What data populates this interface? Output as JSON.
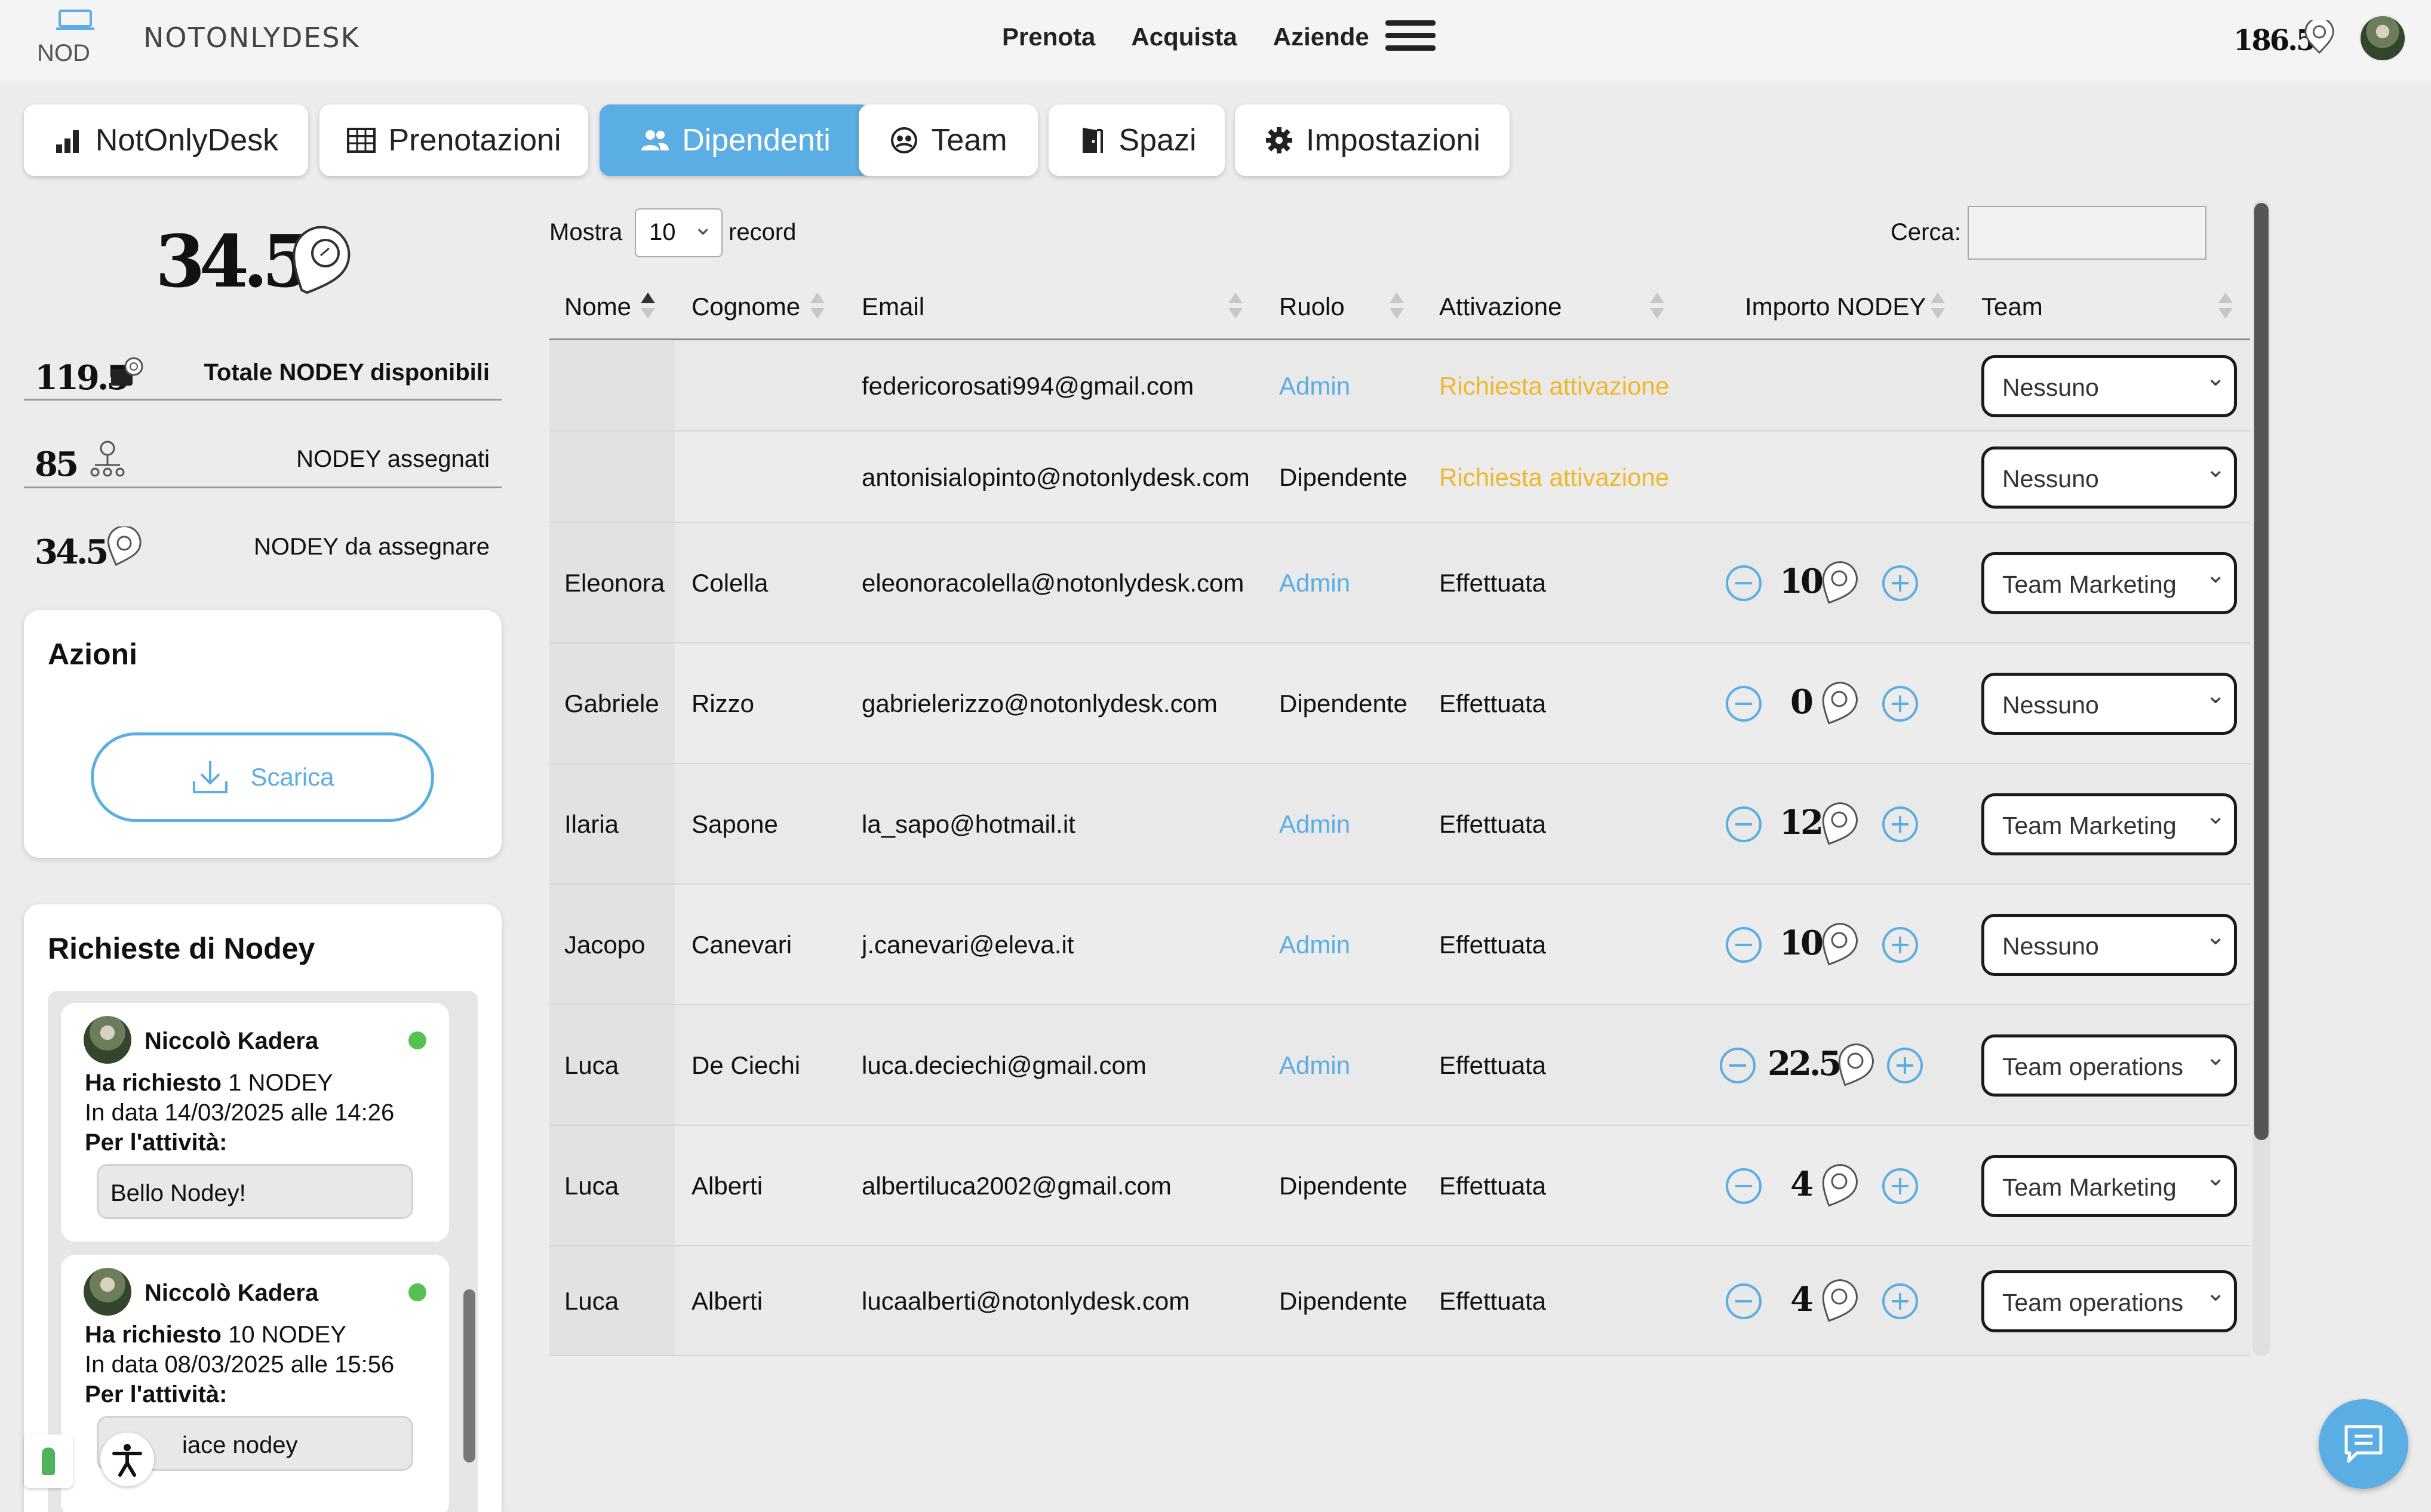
{
  "header": {
    "brand": "NOTONLYDESK",
    "logo_text": "NOD",
    "nav": [
      {
        "label": "Prenota"
      },
      {
        "label": "Acquista"
      },
      {
        "label": "Aziende"
      }
    ],
    "balance": "186.5",
    "balance_icon": "nodey-coin-icon",
    "menu_icon": "hamburger-icon"
  },
  "tabs": [
    {
      "label": "NotOnlyDesk",
      "icon": "bar-chart-icon"
    },
    {
      "label": "Prenotazioni",
      "icon": "table-icon"
    },
    {
      "label": "Dipendenti",
      "icon": "users-icon",
      "active": true
    },
    {
      "label": "Team",
      "icon": "team-icon"
    },
    {
      "label": "Spazi",
      "icon": "door-icon"
    },
    {
      "label": "Impostazioni",
      "icon": "gear-icon"
    }
  ],
  "summary": {
    "big_value": "34.5",
    "stats": [
      {
        "value": "119.5",
        "label": "Totale NODEY disponibili",
        "icon": "wallet-icon"
      },
      {
        "value": "85",
        "label": "NODEY assegnati",
        "icon": "network-icon"
      },
      {
        "value": "34.5",
        "label": "NODEY da assegnare",
        "icon": "nodey-coin-icon"
      }
    ]
  },
  "actions": {
    "title": "Azioni",
    "download_label": "Scarica"
  },
  "requests": {
    "title": "Richieste di Nodey",
    "items": [
      {
        "name": "Niccolò Kadera",
        "requested_prefix": "Ha richiesto",
        "requested_value": "1 NODEY",
        "date": "In data 14/03/2025 alle 14:26",
        "activity_label": "Per l'attività:",
        "activity": "Bello Nodey!"
      },
      {
        "name": "Niccolò Kadera",
        "requested_prefix": "Ha richiesto",
        "requested_value": "10 NODEY",
        "date": "In data 08/03/2025 alle 15:56",
        "activity_label": "Per l'attività:",
        "activity": "iace nodey"
      }
    ]
  },
  "table_controls": {
    "show_label": "Mostra",
    "page_length": "10",
    "record_label": "record",
    "search_label": "Cerca:",
    "search_value": ""
  },
  "table": {
    "columns": [
      "Nome",
      "Cognome",
      "Email",
      "Ruolo",
      "Attivazione",
      "Importo NODEY",
      "Team"
    ],
    "sorted_column": "Nome",
    "rows": [
      {
        "nome": "",
        "cognome": "",
        "email": "federicorosati994@gmail.com",
        "ruolo": "Admin",
        "attivazione": "Richiesta attivazione",
        "importo": null,
        "team": "Nessuno"
      },
      {
        "nome": "",
        "cognome": "",
        "email": "antonisialopinto@notonlydesk.com",
        "ruolo": "Dipendente",
        "attivazione": "Richiesta attivazione",
        "importo": null,
        "team": "Nessuno"
      },
      {
        "nome": "Eleonora",
        "cognome": "Colella",
        "email": "eleonoracolella@notonlydesk.com",
        "ruolo": "Admin",
        "attivazione": "Effettuata",
        "importo": "10",
        "team": "Team Marketing"
      },
      {
        "nome": "Gabriele",
        "cognome": "Rizzo",
        "email": "gabrielerizzo@notonlydesk.com",
        "ruolo": "Dipendente",
        "attivazione": "Effettuata",
        "importo": "0",
        "team": "Nessuno"
      },
      {
        "nome": "Ilaria",
        "cognome": "Sapone",
        "email": "la_sapo@hotmail.it",
        "ruolo": "Admin",
        "attivazione": "Effettuata",
        "importo": "12",
        "team": "Team Marketing"
      },
      {
        "nome": "Jacopo",
        "cognome": "Canevari",
        "email": "j.canevari@eleva.it",
        "ruolo": "Admin",
        "attivazione": "Effettuata",
        "importo": "10",
        "team": "Nessuno"
      },
      {
        "nome": "Luca",
        "cognome": "De Ciechi",
        "email": "luca.deciechi@gmail.com",
        "ruolo": "Admin",
        "attivazione": "Effettuata",
        "importo": "22.5",
        "team": "Team operations"
      },
      {
        "nome": "Luca",
        "cognome": "Alberti",
        "email": "albertiluca2002@gmail.com",
        "ruolo": "Dipendente",
        "attivazione": "Effettuata",
        "importo": "4",
        "team": "Team Marketing"
      },
      {
        "nome": "Luca",
        "cognome": "Alberti",
        "email": "lucaalberti@notonlydesk.com",
        "ruolo": "Dipendente",
        "attivazione": "Effettuata",
        "importo": "4",
        "team": "Team operations"
      }
    ]
  },
  "colors": {
    "accent": "#5aaee3",
    "pending": "#f0b72c",
    "online": "#56c153"
  },
  "widgets": {
    "chat_icon": "chat-bubble-icon",
    "accessibility_icon": "accessibility-icon"
  }
}
